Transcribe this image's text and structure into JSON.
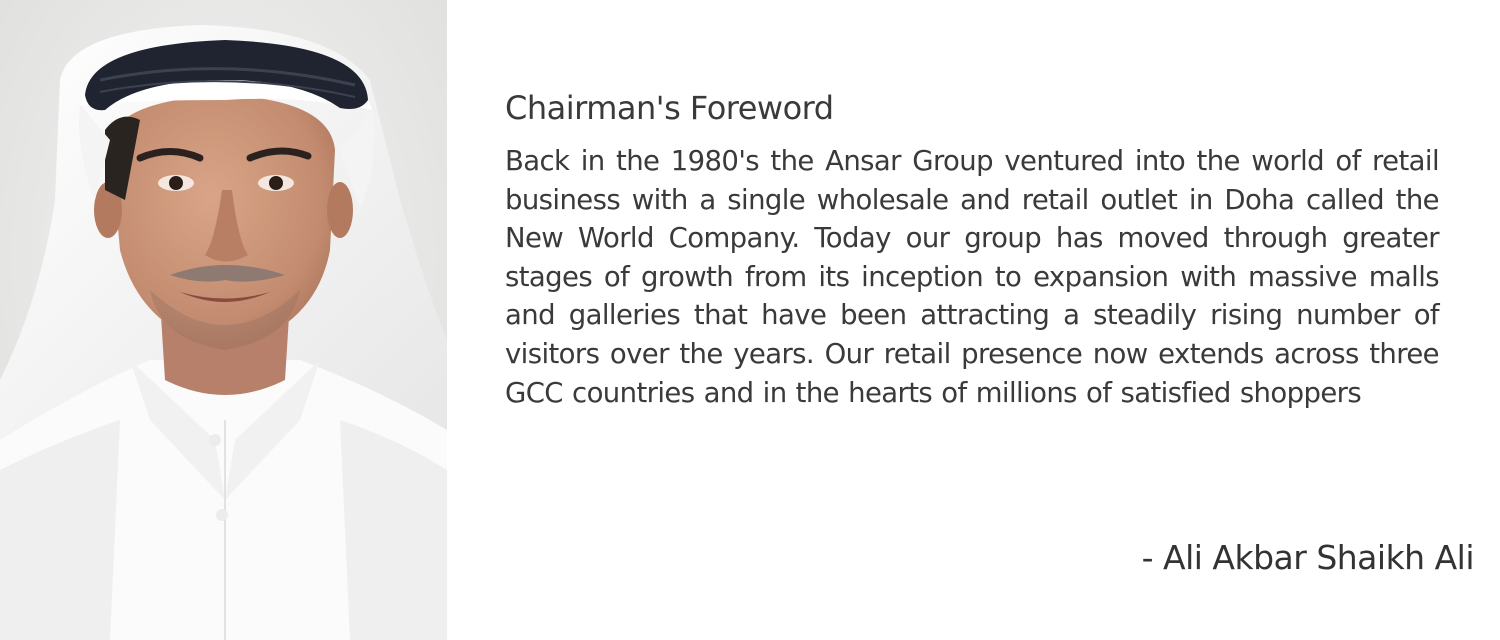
{
  "foreword": {
    "title": "Chairman's Foreword",
    "body": "Back in the 1980's the Ansar Group ventured into the world of retail business with a single wholesale and retail outlet in Doha called the New World Company. Today our group has moved through greater stages of growth from its inception to expansion with massive malls and galler­ies that have been attracting a steadily rising number of visitors over the years. Our retail presence now extends across three GCC countries and in the hearts of millions of satisfied shoppers",
    "signature": "- Ali Akbar Shaikh Ali"
  },
  "portrait": {
    "subject": "chairman-portrait",
    "colors": {
      "background": "#e9e9e8",
      "headdress": "#f7f7f7",
      "agal": "#1f2430",
      "skin": "#c99377",
      "robe": "#fbfbfb"
    }
  }
}
